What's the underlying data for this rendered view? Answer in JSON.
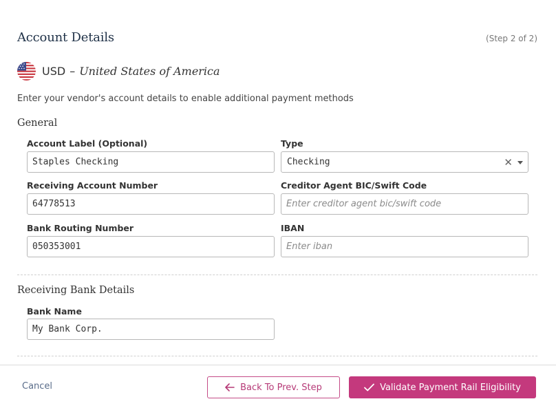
{
  "header": {
    "title": "Account Details",
    "step": "(Step 2 of 2)"
  },
  "currency": {
    "code": "USD",
    "separator": "–",
    "country": "United States of America",
    "flag_icon": "us-flag-icon"
  },
  "intro": "Enter your vendor's account details to enable additional payment methods",
  "general": {
    "section_title": "General",
    "account_label": {
      "label": "Account Label (Optional)",
      "value": "Staples Checking"
    },
    "type": {
      "label": "Type",
      "value": "Checking"
    },
    "receiving_account_number": {
      "label": "Receiving Account Number",
      "value": "64778513"
    },
    "creditor_bic": {
      "label": "Creditor Agent BIC/Swift Code",
      "value": "",
      "placeholder": "Enter creditor agent bic/swift code"
    },
    "bank_routing_number": {
      "label": "Bank Routing Number",
      "value": "050353001"
    },
    "iban": {
      "label": "IBAN",
      "value": "",
      "placeholder": "Enter iban"
    }
  },
  "receiving_bank": {
    "section_title": "Receiving Bank Details",
    "bank_name": {
      "label": "Bank Name",
      "value": "My Bank Corp."
    }
  },
  "footer": {
    "cancel": "Cancel",
    "back": "Back To Prev. Step",
    "validate": "Validate Payment Rail Eligibility"
  },
  "colors": {
    "accent": "#c4397d",
    "title": "#1f3147",
    "link": "#5a6d8a"
  }
}
